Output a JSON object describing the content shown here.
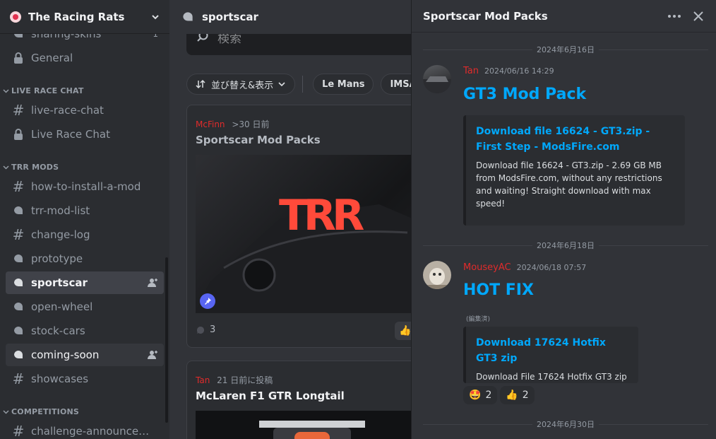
{
  "server": {
    "name": "The Racing Rats"
  },
  "sidebar": {
    "channels_top": [
      {
        "label": "sharing-skins",
        "icon": "forum-icon",
        "badge": "1"
      },
      {
        "label": "General",
        "icon": "lock-icon"
      }
    ],
    "categories": [
      {
        "label": "LIVE RACE CHAT",
        "channels": [
          {
            "label": "live-race-chat",
            "icon": "hash-icon"
          },
          {
            "label": "Live Race Chat",
            "icon": "lock-icon"
          }
        ]
      },
      {
        "label": "TRR MODS",
        "channels": [
          {
            "label": "how-to-install-a-mod",
            "icon": "hash-icon"
          },
          {
            "label": "trr-mod-list",
            "icon": "forum-icon"
          },
          {
            "label": "change-log",
            "icon": "hash-icon"
          },
          {
            "label": "prototype",
            "icon": "forum-icon"
          },
          {
            "label": "sportscar",
            "icon": "forum-icon",
            "state": "active"
          },
          {
            "label": "open-wheel",
            "icon": "forum-icon"
          },
          {
            "label": "stock-cars",
            "icon": "forum-icon"
          },
          {
            "label": "coming-soon",
            "icon": "forum-icon",
            "state": "unread"
          },
          {
            "label": "showcases",
            "icon": "hash-icon"
          }
        ]
      },
      {
        "label": "COMPETITIONS",
        "channels": [
          {
            "label": "challenge-announcemen...",
            "icon": "hash-icon"
          }
        ]
      }
    ]
  },
  "main": {
    "channel_title": "sportscar",
    "search_placeholder": "検索",
    "sort_label": "並び替え&表示",
    "tags": [
      "Le Mans",
      "IMSA"
    ],
    "posts": [
      {
        "author": "McFinn",
        "time": ">30 日前",
        "title": "Sportscar Mod Packs",
        "replies": "3",
        "logo_text": "TRR"
      },
      {
        "author": "Tan",
        "time": "21 日前に投稿",
        "title": "McLaren F1 GTR Longtail"
      }
    ]
  },
  "thread": {
    "title": "Sportscar Mod Packs",
    "messages": [
      {
        "date_divider": "2024年6月16日",
        "author": "Tan",
        "timestamp": "2024/06/16 14:29",
        "heading": "GT3 Mod Pack",
        "embed": {
          "title": "Download file 16624 - GT3.zip - First Step - ModsFire.com",
          "description": "Download file 16624 - GT3.zip - 2.69 GB MB from ModsFire.com, without any restrictions and waiting! Straight download with max speed!"
        }
      },
      {
        "date_divider": "2024年6月18日",
        "author": "MouseyAC",
        "timestamp": "2024/06/18 07:57",
        "heading": "HOT FIX",
        "edited": "(編集済)",
        "embed": {
          "title": "Download 17624 Hotfix GT3 zip",
          "description": "Download File 17624 Hotfix GT3 zip"
        },
        "reactions": [
          {
            "emoji": "🤩",
            "count": "2"
          },
          {
            "emoji": "👍",
            "count": "2"
          }
        ]
      }
    ],
    "last_date_divider": "2024年6月30日"
  },
  "colors": {
    "sidebar_bg": "#2b2d31",
    "main_bg": "#313338",
    "author_red": "#e02b2b",
    "link_blue": "#00a8fc",
    "active_bg": "#404249"
  }
}
